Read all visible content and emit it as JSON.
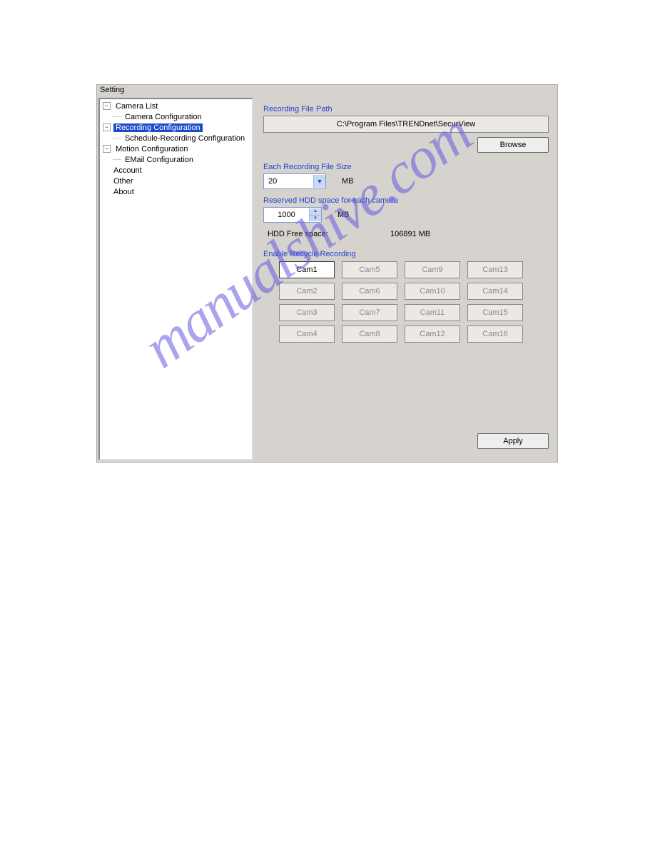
{
  "window": {
    "title": "Setting"
  },
  "tree": {
    "items": [
      {
        "label": "Camera List"
      },
      {
        "label": "Camera Configuration"
      },
      {
        "label": "Recording Configuration"
      },
      {
        "label": "Schedule-Recording Configuration"
      },
      {
        "label": "Motion Configuration"
      },
      {
        "label": "EMail Configuration"
      },
      {
        "label": "Account"
      },
      {
        "label": "Other"
      },
      {
        "label": "About"
      }
    ]
  },
  "recording": {
    "path_label": "Recording File Path",
    "path_value": "C:\\Program Files\\TRENDnet\\SecurView",
    "browse_label": "Browse",
    "filesize_label": "Each Recording File Size",
    "filesize_value": "20",
    "filesize_unit": "MB",
    "reserved_label": "Reserved HDD space for each camera",
    "reserved_value": "1000",
    "reserved_unit": "MB",
    "free_label": "HDD Free space:",
    "free_value": "106891  MB",
    "recycle_label": "Enable Recycle Recording",
    "apply_label": "Apply"
  },
  "cams": [
    "Cam1",
    "Cam5",
    "Cam9",
    "Cam13",
    "Cam2",
    "Cam6",
    "Cam10",
    "Cam14",
    "Cam3",
    "Cam7",
    "Cam11",
    "Cam15",
    "Cam4",
    "Cam8",
    "Cam12",
    "Cam16"
  ],
  "watermark": "manualshive.com"
}
